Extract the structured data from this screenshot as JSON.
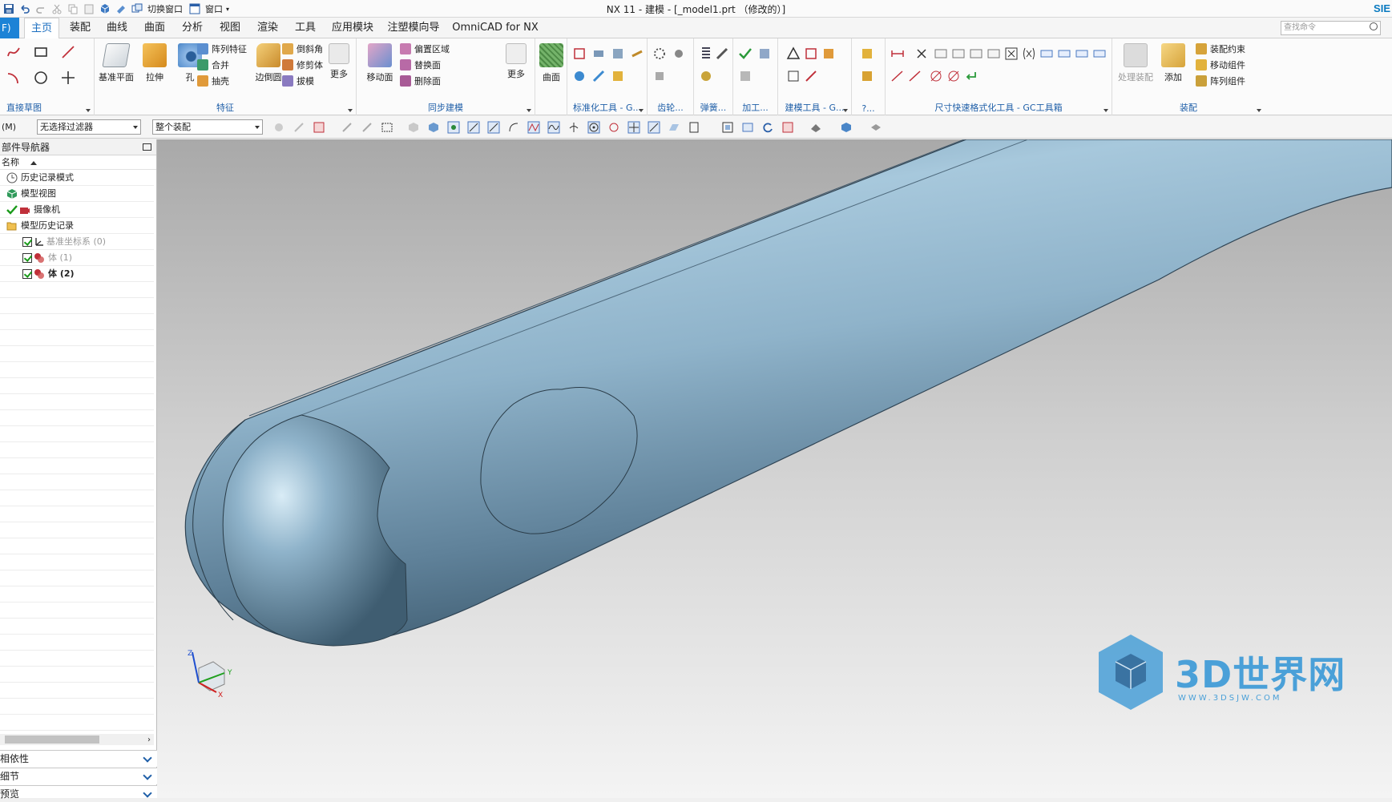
{
  "window": {
    "title": "NX 11 - 建模 - [_model1.prt （修改的）]",
    "brand": "SIE"
  },
  "quick_access": {
    "switch_window": "切换窗口",
    "window": "窗口"
  },
  "menu": {
    "file": "F)",
    "tabs": [
      "主页",
      "装配",
      "曲线",
      "曲面",
      "分析",
      "视图",
      "渲染",
      "工具",
      "应用模块",
      "注塑模向导",
      "OmniCAD for NX"
    ],
    "active_tab": "主页",
    "search_placeholder": "查找命令"
  },
  "ribbon": {
    "direct_sketch": {
      "label": "直接草图"
    },
    "feature": {
      "label": "特征",
      "datum_plane": "基准平面",
      "extrude": "拉伸",
      "hole": "孔",
      "pattern_feature": "阵列特征",
      "unite": "合并",
      "shell": "抽壳",
      "edge_blend": "边倒圆",
      "chamfer": "倒斜角",
      "trim_body": "修剪体",
      "draft": "拔模",
      "more": "更多"
    },
    "sync_modeling": {
      "label": "同步建模",
      "move_face": "移动面",
      "offset_region": "偏置区域",
      "replace_face": "替换面",
      "delete_face": "删除面",
      "more": "更多"
    },
    "surface": {
      "label": "",
      "surface": "曲面"
    },
    "std_tools": {
      "label": "标准化工具 - G..."
    },
    "gear": {
      "label": "齿轮..."
    },
    "spring": {
      "label": "弹簧..."
    },
    "machining": {
      "label": "加工..."
    },
    "build_tools": {
      "label": "建模工具 - G..."
    },
    "ellipsis": {
      "label": "?..."
    },
    "dim_tools": {
      "label": "尺寸快速格式化工具 - GC工具箱"
    },
    "assembly": {
      "label": "装配",
      "process_assembly": "处理装配",
      "add": "添加",
      "assembly_constraints": "装配约束",
      "move_component": "移动组件",
      "pattern_component": "阵列组件"
    }
  },
  "toolbar2": {
    "menu_label": "(M)",
    "selection_filter": "无选择过滤器",
    "assembly_scope": "整个装配"
  },
  "navigator": {
    "title": "部件导航器",
    "column_name": "名称",
    "items": [
      {
        "label": "历史记录模式"
      },
      {
        "label": "模型视图"
      },
      {
        "label": "摄像机"
      },
      {
        "label": "模型历史记录"
      },
      {
        "label": "基准坐标系 (0)"
      },
      {
        "label": "体 (1)"
      },
      {
        "label": "体 (2)"
      }
    ],
    "panels": [
      "相依性",
      "细节",
      "预览"
    ]
  },
  "viewport": {
    "triad": {
      "x": "X",
      "y": "Y",
      "z": "Z"
    },
    "watermark": {
      "big": "3D世界网",
      "small": "WWW.3DSJW.COM"
    }
  },
  "colors": {
    "accent": "#1c83d6",
    "model_body": "#7fa6bf",
    "watermark": "#4aa0d8"
  }
}
